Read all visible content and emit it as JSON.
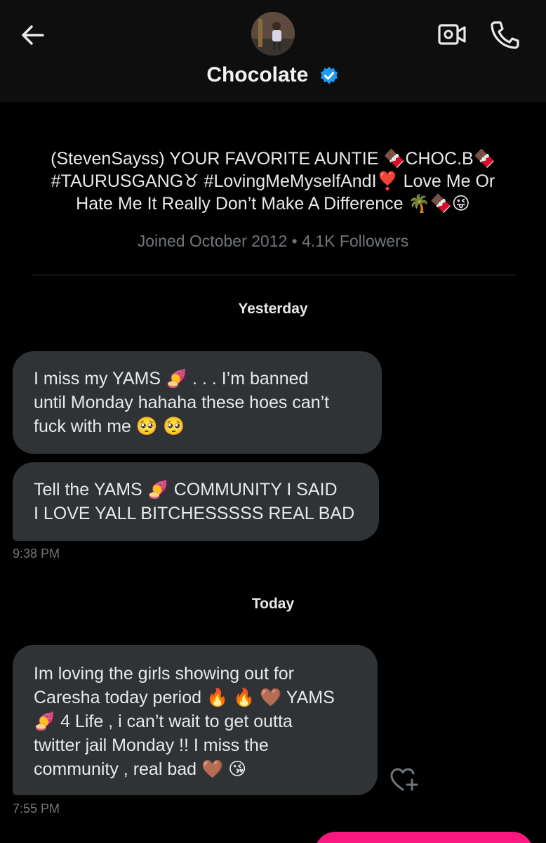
{
  "header": {
    "contact_name": "Chocolate",
    "icons": {
      "back": "arrow-left-icon",
      "video": "video-call-icon",
      "phone": "phone-call-icon",
      "verified": "verified-badge-icon"
    },
    "verified_color": "#1d9bf0"
  },
  "profile": {
    "bio_line1": "(StevenSayss) YOUR FAVORITE AUNTIE 🍫CHOC.B🍫",
    "bio_line2": "#TAURUSGANG♉ #LovingMeMyselfAndI❣️ Love Me Or",
    "bio_line3": "Hate Me It Really Don’t Make A Difference 🌴🍫😜",
    "meta": "Joined October 2012 • 4.1K Followers"
  },
  "conversation": {
    "yesterday_label": "Yesterday",
    "messages_yesterday": [
      {
        "lines": [
          "I miss my YAMS 🍠 . . . I’m banned",
          "until Monday hahaha these hoes can’t",
          "fuck with me 🥺 🥺"
        ]
      },
      {
        "lines": [
          "Tell the YAMS 🍠 COMMUNITY I SAID",
          "I LOVE YALL BITCHESSSSS REAL BAD"
        ]
      }
    ],
    "yesterday_time": "9:38 PM",
    "today_label": "Today",
    "messages_today": [
      {
        "lines": [
          "Im loving the girls showing out for",
          "Caresha today period 🔥 🔥 🤎 YAMS",
          "🍠 4 Life , i can’t wait to get outta",
          "twitter jail Monday !! I miss the",
          "community , real bad 🤎 😘"
        ]
      }
    ],
    "today_time": "7:55 PM",
    "reaction_icon": "heart-plus-icon"
  },
  "colors": {
    "background": "#000000",
    "bubble": "#2f3336",
    "muted_text": "#71767b",
    "accent_pink": "#f91880"
  }
}
